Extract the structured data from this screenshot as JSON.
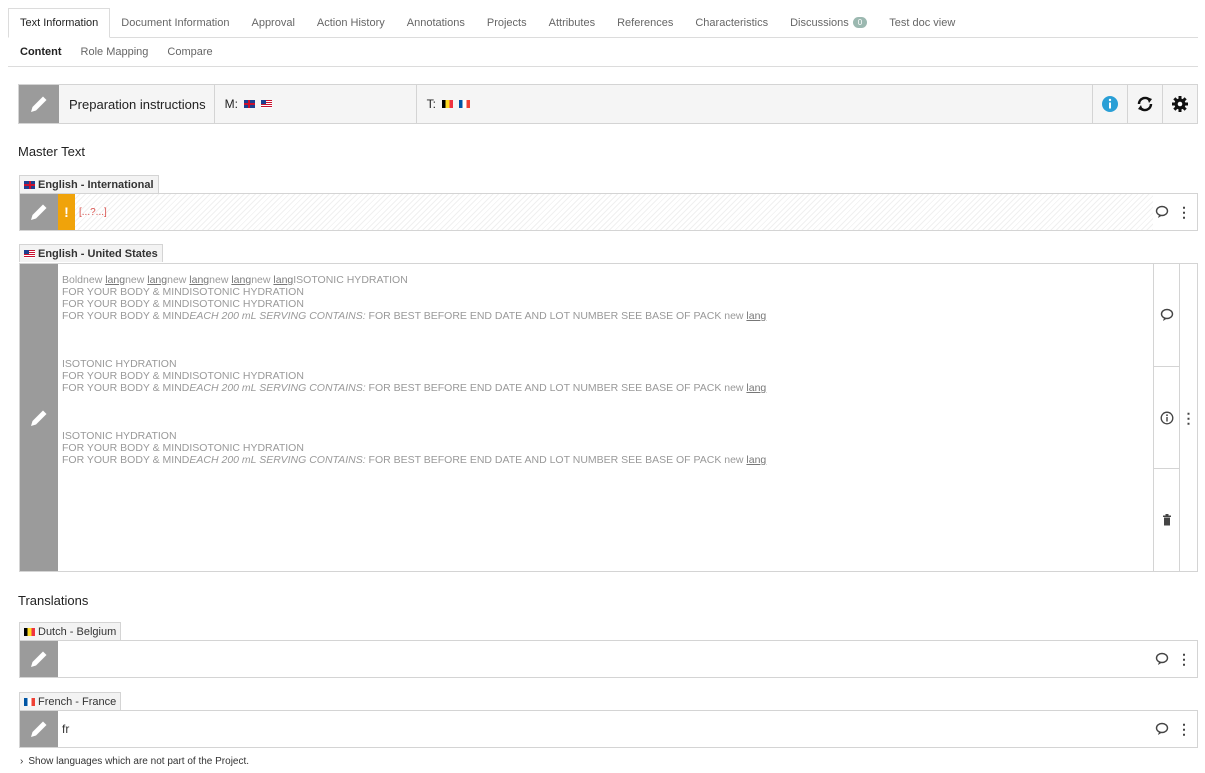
{
  "tabs": [
    {
      "label": "Text Information"
    },
    {
      "label": "Document Information"
    },
    {
      "label": "Approval"
    },
    {
      "label": "Action History"
    },
    {
      "label": "Annotations"
    },
    {
      "label": "Projects"
    },
    {
      "label": "Attributes"
    },
    {
      "label": "References"
    },
    {
      "label": "Characteristics"
    },
    {
      "label": "Discussions",
      "badge": "0"
    },
    {
      "label": "Test doc view"
    }
  ],
  "subtabs": [
    {
      "label": "Content"
    },
    {
      "label": "Role Mapping"
    },
    {
      "label": "Compare"
    }
  ],
  "toolbar": {
    "title": "Preparation instructions",
    "master_label": "M:",
    "translation_label": "T:"
  },
  "master": {
    "title": "Master Text",
    "intl": {
      "label": "English - International",
      "content": "[...?...]"
    },
    "us": {
      "label": "English - United States",
      "para1_line1_parts": [
        "Bold",
        "new ",
        "lang",
        "new ",
        "lang",
        "new ",
        "lang",
        "new ",
        "lang",
        "new ",
        "lang",
        "ISOTONIC HYDRATION"
      ],
      "para1_line2": "FOR YOUR BODY & MINDISOTONIC HYDRATION",
      "para1_line3": "FOR YOUR BODY & MINDISOTONIC HYDRATION",
      "line_prefix": "FOR YOUR BODY & MIND",
      "serving": "EACH 200 mL SERVING CONTAINS:",
      "best_before": " FOR BEST BEFORE END DATE AND LOT NUMBER SEE BASE OF PACK  new ",
      "lang_word": "lang",
      "para2_line1": "ISOTONIC HYDRATION",
      "para2_line2": "FOR YOUR BODY & MINDISOTONIC HYDRATION",
      "para3_line1": "ISOTONIC HYDRATION",
      "para3_line2": "FOR YOUR BODY & MINDISOTONIC HYDRATION"
    }
  },
  "translations": {
    "title": "Translations",
    "items": [
      {
        "label": "Dutch - Belgium",
        "content": ""
      },
      {
        "label": "French - France",
        "content": "fr"
      }
    ]
  },
  "footer": {
    "show_languages": "Show languages which are not part of the Project."
  },
  "colors": {
    "pencil_bg": "#9b9b9b",
    "warning": "#f0a30a",
    "info_blue": "#2a9fd6",
    "missing_red": "#d9534f"
  }
}
